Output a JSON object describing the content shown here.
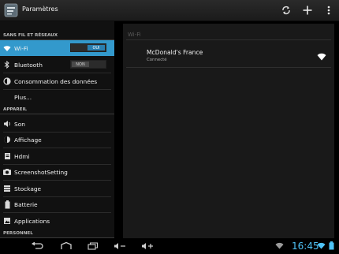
{
  "app": {
    "title": "Paramètres"
  },
  "actionbar_icons": [
    "sync-icon",
    "add-icon",
    "overflow-menu-icon"
  ],
  "sidebar": {
    "sections": [
      {
        "label": "SANS FIL ET RÉSEAUX"
      },
      {
        "label": "APPAREIL"
      },
      {
        "label": "PERSONNEL"
      }
    ],
    "items": [
      {
        "label": "Wi-Fi",
        "toggle": "OUI",
        "selected": true,
        "icon": "wifi-icon"
      },
      {
        "label": "Bluetooth",
        "toggle": "NON",
        "icon": "bluetooth-icon"
      },
      {
        "label": "Consommation des données",
        "icon": "data-usage-icon"
      },
      {
        "label": "Plus..."
      },
      {
        "label": "Son",
        "icon": "sound-icon"
      },
      {
        "label": "Affichage",
        "icon": "display-icon"
      },
      {
        "label": "Hdmi",
        "icon": "hdmi-icon"
      },
      {
        "label": "ScreenshotSetting",
        "icon": "screenshot-icon"
      },
      {
        "label": "Stockage",
        "icon": "storage-icon"
      },
      {
        "label": "Batterie",
        "icon": "battery-icon"
      },
      {
        "label": "Applications",
        "icon": "applications-icon"
      }
    ]
  },
  "main": {
    "header": "Wi-Fi",
    "networks": [
      {
        "name": "McDonald's France",
        "status": "Connecté",
        "icon": "wifi-signal-icon"
      }
    ]
  },
  "systembar": {
    "clock": "16:45",
    "accent": "#4fc3f7"
  }
}
